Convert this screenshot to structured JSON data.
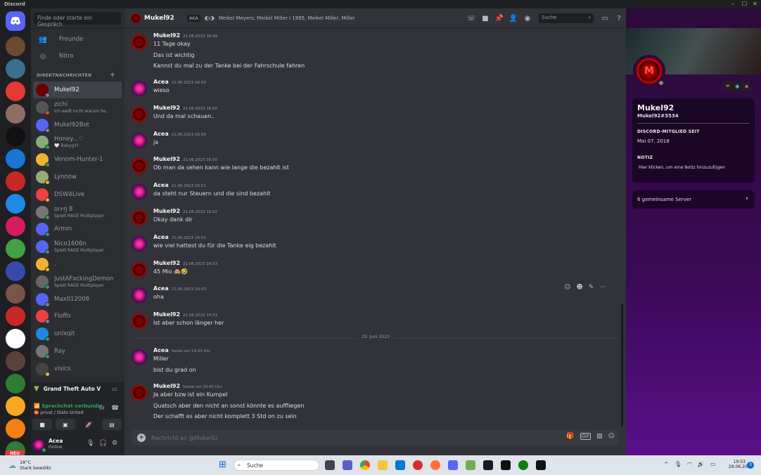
{
  "window": {
    "title": "Discord"
  },
  "dm_sidebar": {
    "search_placeholder": "Finde oder starte ein Gespräch",
    "nav": [
      {
        "label": "Freunde",
        "icon": "friends-icon"
      },
      {
        "label": "Nitro",
        "icon": "nitro-icon"
      }
    ],
    "dm_header": "DIREKTNACHRICHTEN",
    "dms": [
      {
        "name": "Mukel92",
        "sub": "",
        "status": "offline"
      },
      {
        "name": "zichi",
        "sub": "Ich weiß nicht warum be...",
        "status": "dnd"
      },
      {
        "name": "Mukel92Bot",
        "sub": "",
        "status": "offline"
      },
      {
        "name": "Honey...♡",
        "sub": "🤍 Babygirl",
        "status": "online"
      },
      {
        "name": "Venom-Hunter-1",
        "sub": "",
        "status": "online"
      },
      {
        "name": "Lynnow",
        "sub": "",
        "status": "idle"
      },
      {
        "name": "DSW4Live",
        "sub": "",
        "status": "idle"
      },
      {
        "name": "ɑıʏŋ 8",
        "sub": "Spielt RAGE Multiplayer",
        "status": "online"
      },
      {
        "name": "Armin",
        "sub": "",
        "status": "online"
      },
      {
        "name": "Nico1606n",
        "sub": "Spielt RAGE Multiplayer",
        "status": "online"
      },
      {
        "name": ".",
        "sub": "",
        "status": "idle"
      },
      {
        "name": "JustAFxckingDemon",
        "sub": "Spielt RAGE Multiplayer",
        "status": "online"
      },
      {
        "name": "Max012008",
        "sub": "",
        "status": "offline"
      },
      {
        "name": "Floffo",
        "sub": "",
        "status": "offline"
      },
      {
        "name": "unlxqit",
        "sub": "",
        "status": "online"
      },
      {
        "name": "Ray",
        "sub": "",
        "status": "online"
      },
      {
        "name": "visics",
        "sub": "",
        "status": "idle"
      }
    ],
    "activity": {
      "game": "Grand Theft Auto V"
    },
    "voice": {
      "status": "Sprachchat verbunde",
      "channel": "privat / State United"
    },
    "user": {
      "name": "Acea",
      "status": "Online"
    }
  },
  "guilds": {
    "new_badge": "NEU"
  },
  "chat": {
    "channel_name": "Mukel92",
    "aka_label": "AKA",
    "aka_names": "Meikel Meyers, Meikel Miller I 1995, Meikel Miller, Miller",
    "search_placeholder": "Suche",
    "date_separator": "29. Juni 2023",
    "messages": [
      {
        "author": "Mukel92",
        "time": "21.06.2023 16:49",
        "lines": [
          "11 Tage okay",
          "Das ist wichtig",
          "Kannst du mal zu der Tanke bei der Fahrschule fahren"
        ]
      },
      {
        "author": "Acea",
        "time": "21.06.2023 16:50",
        "lines": [
          "wieso"
        ]
      },
      {
        "author": "Mukel92",
        "time": "21.06.2023 16:50",
        "lines": [
          "Und da mal schauen.."
        ]
      },
      {
        "author": "Acea",
        "time": "21.06.2023 16:50",
        "lines": [
          "ja"
        ]
      },
      {
        "author": "Mukel92",
        "time": "21.06.2023 16:50",
        "lines": [
          "Ob man da sehen kann wie lange die bezahlt ist"
        ]
      },
      {
        "author": "Acea",
        "time": "21.06.2023 16:51",
        "lines": [
          "da steht nur Steuern und die sind bezahlt"
        ]
      },
      {
        "author": "Mukel92",
        "time": "21.06.2023 16:52",
        "lines": [
          "Okay dank dir"
        ]
      },
      {
        "author": "Acea",
        "time": "21.06.2023 16:52",
        "lines": [
          "wie viel hattest du für die Tanke eig bezahlt"
        ]
      },
      {
        "author": "Mukel92",
        "time": "21.06.2023 16:53",
        "lines": [
          "45 Mio 🙈🤣"
        ]
      },
      {
        "author": "Acea",
        "time": "21.06.2023 16:53",
        "lines": [
          "oha"
        ]
      },
      {
        "author": "Mukel92",
        "time": "21.06.2023 16:53",
        "lines": [
          "Ist aber schon länger her"
        ]
      },
      {
        "author": "Acea",
        "time": "heute um 19:33 Uhr",
        "lines": [
          "Miller",
          "bist du grad on"
        ]
      },
      {
        "author": "Mukel92",
        "time": "heute um 19:41 Uhr",
        "lines": [
          "Ja aber bzw ist ein Kumpel",
          "Quatsch aber den nicht an sonst könnte es auffliegen",
          "Der schafft es aber nicht komplett 3 Std on zu sein"
        ]
      }
    ],
    "input_placeholder": "Nachricht an @Mukel92"
  },
  "profile": {
    "display_name": "Mukel92",
    "tag": "Mukel92#3534",
    "member_since_label": "DISCORD-MITGLIED SEIT",
    "member_since": "Mai 07, 2018",
    "note_label": "NOTIZ",
    "note_placeholder": "Hier klicken, um eine Notiz hinzuzufügen",
    "mutual_servers": "6 gemeinsame Server",
    "avatar_letter": "M"
  },
  "taskbar": {
    "weather_temp": "18°C",
    "weather_desc": "Stark bewölkt",
    "search": "Suche",
    "time": "19:53",
    "date": "29.06.2023",
    "notification_count": "3"
  },
  "colors": {
    "online": "#23a55a",
    "idle": "#f0b232",
    "dnd": "#f23f43",
    "offline": "#80848e",
    "blurple": "#5865f2"
  }
}
